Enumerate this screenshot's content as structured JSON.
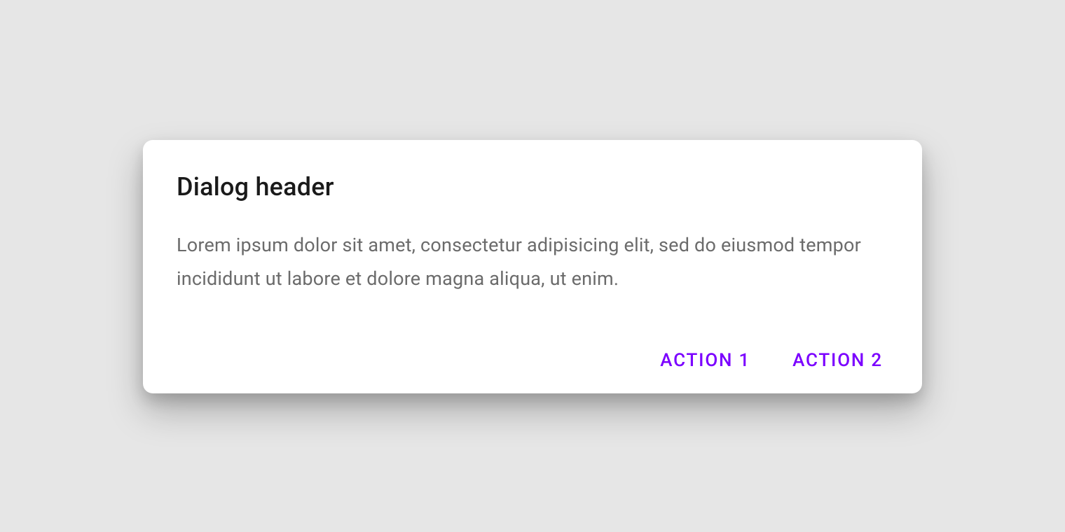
{
  "dialog": {
    "title": "Dialog header",
    "body": "Lorem ipsum dolor sit amet, consectetur adipisicing elit, sed do eiusmod tempor incididunt ut labore et dolore magna aliqua, ut enim.",
    "actions": {
      "action1": "ACTION 1",
      "action2": "ACTION 2"
    }
  },
  "colors": {
    "background": "#e6e6e6",
    "dialog_bg": "#ffffff",
    "title": "#1a1a1a",
    "body_text": "#6b6b6b",
    "accent": "#7b00ff"
  }
}
